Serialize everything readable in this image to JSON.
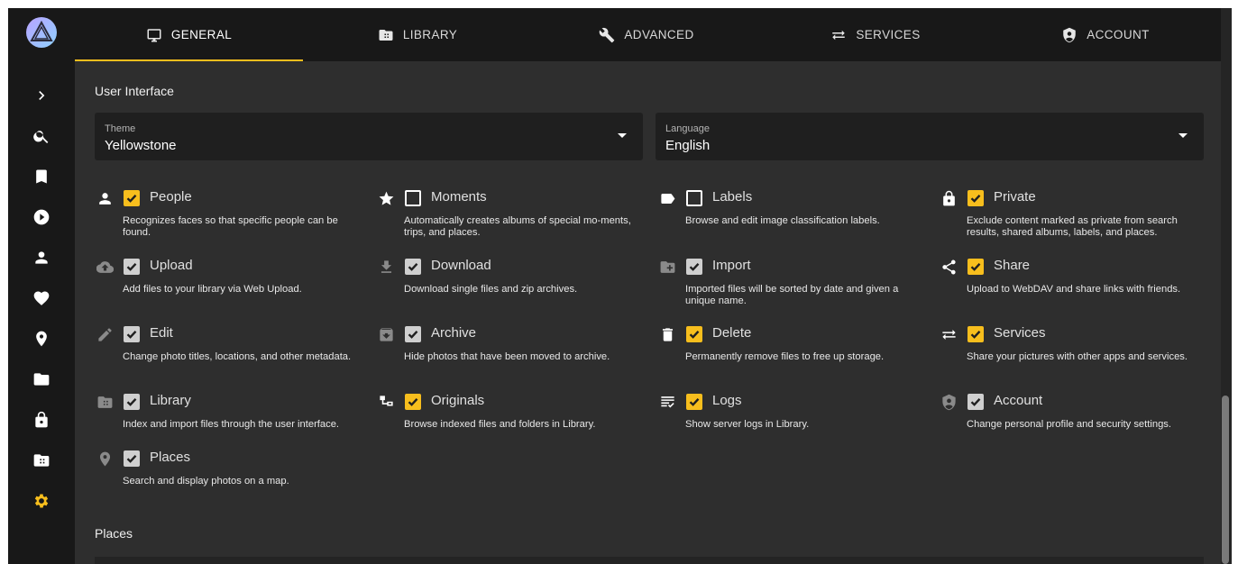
{
  "tabs": [
    {
      "label": "General",
      "icon": "monitor-icon",
      "active": true
    },
    {
      "label": "Library",
      "icon": "film-folder-icon",
      "active": false
    },
    {
      "label": "Advanced",
      "icon": "wrench-icon",
      "active": false
    },
    {
      "label": "Services",
      "icon": "swap-icon",
      "active": false
    },
    {
      "label": "Account",
      "icon": "shield-account-icon",
      "active": false
    }
  ],
  "sidebar": {
    "items": [
      "expand-icon",
      "search-icon",
      "bookmark-icon",
      "play-icon",
      "person-icon",
      "heart-icon",
      "location-icon",
      "folder-icon",
      "lock-icon",
      "film-folder-icon",
      "gear-icon"
    ],
    "active": "gear-icon"
  },
  "user_interface": {
    "title": "User Interface",
    "theme": {
      "label": "Theme",
      "value": "Yellowstone"
    },
    "language": {
      "label": "Language",
      "value": "English"
    }
  },
  "features": [
    {
      "name": "People",
      "icon": "person-icon",
      "state": "on",
      "desc": "Recognizes faces so that specific people can be found."
    },
    {
      "name": "Moments",
      "icon": "star-icon",
      "state": "off",
      "desc": "Automatically creates albums of special mo-ments, trips, and places."
    },
    {
      "name": "Labels",
      "icon": "label-icon",
      "state": "off",
      "desc": "Browse and edit image classification labels."
    },
    {
      "name": "Private",
      "icon": "lock-icon",
      "state": "on",
      "desc": "Exclude content marked as private from search results, shared albums, labels, and places."
    },
    {
      "name": "Upload",
      "icon": "cloud-upload-icon",
      "state": "grey",
      "desc": "Add files to your library via Web Upload."
    },
    {
      "name": "Download",
      "icon": "download-icon",
      "state": "grey",
      "desc": "Download single files and zip archives."
    },
    {
      "name": "Import",
      "icon": "folder-plus-icon",
      "state": "grey",
      "desc": "Imported files will be sorted by date and given a unique name."
    },
    {
      "name": "Share",
      "icon": "share-icon",
      "state": "on",
      "desc": "Upload to WebDAV and share links with friends."
    },
    {
      "name": "Edit",
      "icon": "pencil-icon",
      "state": "grey",
      "desc": "Change photo titles, locations, and other metadata."
    },
    {
      "name": "Archive",
      "icon": "archive-icon",
      "state": "grey",
      "desc": "Hide photos that have been moved to archive."
    },
    {
      "name": "Delete",
      "icon": "trash-icon",
      "state": "on",
      "desc": "Permanently remove files to free up storage."
    },
    {
      "name": "Services",
      "icon": "swap-icon",
      "state": "on",
      "desc": "Share your pictures with other apps and services."
    },
    {
      "name": "Library",
      "icon": "film-folder-icon",
      "state": "grey",
      "desc": "Index and import files through the user interface."
    },
    {
      "name": "Originals",
      "icon": "file-tree-icon",
      "state": "on",
      "desc": "Browse indexed files and folders in Library."
    },
    {
      "name": "Logs",
      "icon": "text-list-icon",
      "state": "on",
      "desc": "Show server logs in Library."
    },
    {
      "name": "Account",
      "icon": "shield-account-icon",
      "state": "grey",
      "desc": "Change personal profile and security settings."
    },
    {
      "name": "Places",
      "icon": "location-icon",
      "state": "grey",
      "desc": "Search and display photos on a map."
    }
  ],
  "places": {
    "title": "Places"
  },
  "colors": {
    "accent": "#f7be1d",
    "background": "#2e2e2e",
    "sidebar": "#181818",
    "field": "#1f1f1f"
  }
}
